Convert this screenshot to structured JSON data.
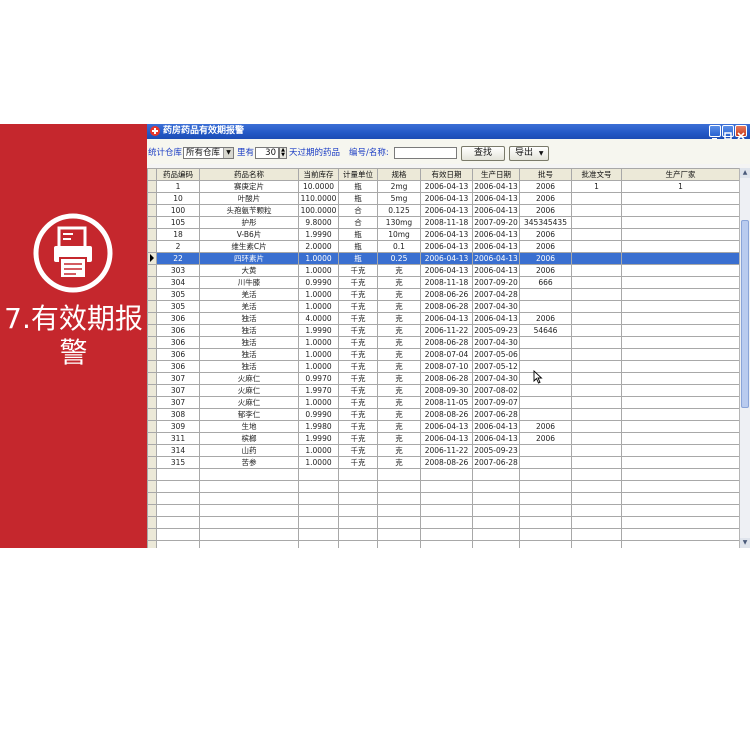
{
  "side_panel": {
    "title": "7.有效期报警",
    "icon": "printer-document-icon",
    "color": "#c5272d"
  },
  "window": {
    "title": "药房药品有效期报警",
    "icon": "red-cross-icon",
    "controls": [
      "minimize-icon",
      "maximize-icon",
      "close-icon"
    ]
  },
  "toolbar": {
    "warehouse_label": "统计仓库",
    "warehouse_value": "所有仓库",
    "within_label": "里有",
    "days_value": "30",
    "days_suffix": "天过期的药品",
    "code_label": "编号/名称:",
    "code_value": "",
    "search_button": "查找",
    "export_button": "导出"
  },
  "table": {
    "headers": [
      "药品编码",
      "药品名称",
      "当前库存",
      "计量单位",
      "规格",
      "有效日期",
      "生产日期",
      "批号",
      "批准文号",
      "生产厂家"
    ],
    "selected_index": 6,
    "rows": [
      [
        "1",
        "赛庚定片",
        "10.0000",
        "瓶",
        "2mg",
        "2006-04-13",
        "2006-04-13",
        "2006",
        "1",
        "1"
      ],
      [
        "10",
        "叶酸片",
        "110.0000",
        "瓶",
        "5mg",
        "2006-04-13",
        "2006-04-13",
        "2006",
        "",
        ""
      ],
      [
        "100",
        "头孢氨苄颗粒",
        "100.0000",
        "合",
        "0.125",
        "2006-04-13",
        "2006-04-13",
        "2006",
        "",
        ""
      ],
      [
        "105",
        "护彤",
        "9.8000",
        "合",
        "130mg",
        "2008-11-18",
        "2007-09-20",
        "345345435",
        "",
        ""
      ],
      [
        "18",
        "V-B6片",
        "1.9990",
        "瓶",
        "10mg",
        "2006-04-13",
        "2006-04-13",
        "2006",
        "",
        ""
      ],
      [
        "2",
        "维生素C片",
        "2.0000",
        "瓶",
        "0.1",
        "2006-04-13",
        "2006-04-13",
        "2006",
        "",
        ""
      ],
      [
        "22",
        "四环素片",
        "1.0000",
        "瓶",
        "0.25",
        "2006-04-13",
        "2006-04-13",
        "2006",
        "",
        ""
      ],
      [
        "303",
        "大黄",
        "1.0000",
        "千克",
        "克",
        "2006-04-13",
        "2006-04-13",
        "2006",
        "",
        ""
      ],
      [
        "304",
        "川牛膝",
        "0.9990",
        "千克",
        "克",
        "2008-11-18",
        "2007-09-20",
        "666",
        "",
        ""
      ],
      [
        "305",
        "羌活",
        "1.0000",
        "千克",
        "克",
        "2008-06-26",
        "2007-04-28",
        "",
        "",
        ""
      ],
      [
        "305",
        "羌活",
        "1.0000",
        "千克",
        "克",
        "2008-06-28",
        "2007-04-30",
        "",
        "",
        ""
      ],
      [
        "306",
        "独活",
        "4.0000",
        "千克",
        "克",
        "2006-04-13",
        "2006-04-13",
        "2006",
        "",
        ""
      ],
      [
        "306",
        "独活",
        "1.9990",
        "千克",
        "克",
        "2006-11-22",
        "2005-09-23",
        "54646",
        "",
        ""
      ],
      [
        "306",
        "独活",
        "1.0000",
        "千克",
        "克",
        "2008-06-28",
        "2007-04-30",
        "",
        "",
        ""
      ],
      [
        "306",
        "独活",
        "1.0000",
        "千克",
        "克",
        "2008-07-04",
        "2007-05-06",
        "",
        "",
        ""
      ],
      [
        "306",
        "独活",
        "1.0000",
        "千克",
        "克",
        "2008-07-10",
        "2007-05-12",
        "",
        "",
        ""
      ],
      [
        "307",
        "火麻仁",
        "0.9970",
        "千克",
        "克",
        "2008-06-28",
        "2007-04-30",
        "",
        "",
        ""
      ],
      [
        "307",
        "火麻仁",
        "1.9970",
        "千克",
        "克",
        "2008-09-30",
        "2007-08-02",
        "",
        "",
        ""
      ],
      [
        "307",
        "火麻仁",
        "1.0000",
        "千克",
        "克",
        "2008-11-05",
        "2007-09-07",
        "",
        "",
        ""
      ],
      [
        "308",
        "郁李仁",
        "0.9990",
        "千克",
        "克",
        "2008-08-26",
        "2007-06-28",
        "",
        "",
        ""
      ],
      [
        "309",
        "生地",
        "1.9980",
        "千克",
        "克",
        "2006-04-13",
        "2006-04-13",
        "2006",
        "",
        ""
      ],
      [
        "311",
        "槟榔",
        "1.9990",
        "千克",
        "克",
        "2006-04-13",
        "2006-04-13",
        "2006",
        "",
        ""
      ],
      [
        "314",
        "山药",
        "1.0000",
        "千克",
        "克",
        "2006-11-22",
        "2005-09-23",
        "",
        "",
        ""
      ],
      [
        "315",
        "苦参",
        "1.0000",
        "千克",
        "克",
        "2008-08-26",
        "2007-06-28",
        "",
        "",
        ""
      ]
    ],
    "empty_rows": 11
  },
  "colors": {
    "titlebar": "#2358c5",
    "selection": "#3a6fd0",
    "label_blue": "#1a3cc4"
  }
}
